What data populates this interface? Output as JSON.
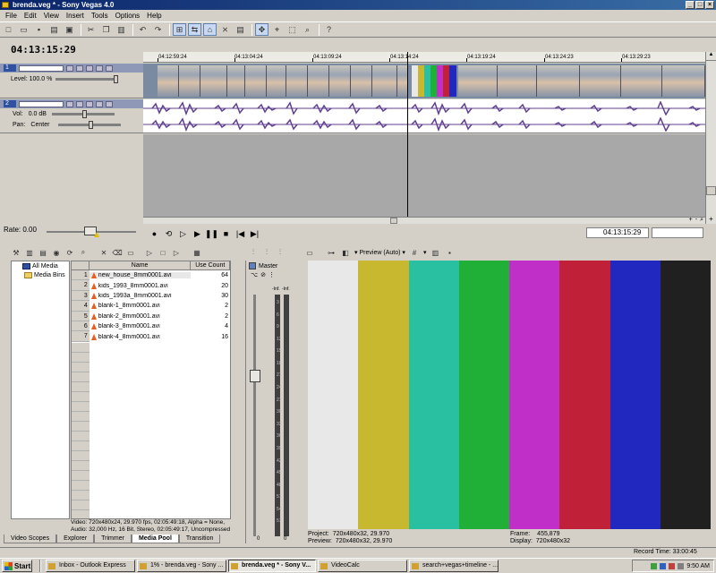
{
  "window": {
    "title": "brenda.veg * - Sony Vegas 4.0",
    "buttons": [
      "_",
      "□",
      "×"
    ]
  },
  "menu": [
    "File",
    "Edit",
    "View",
    "Insert",
    "Tools",
    "Options",
    "Help"
  ],
  "timeline": {
    "cursor_time": "04:13:15:29",
    "ruler_ticks": [
      "04:12:59:24",
      "04:13:04:24",
      "04:13:09:24",
      "04:13:14:24",
      "04:13:19:24",
      "04:13:24:23",
      "04:13:29:23"
    ],
    "end_time": "04:13:15:29"
  },
  "video_track": {
    "number": "1",
    "level_label": "Level: 100.0 %"
  },
  "audio_track": {
    "number": "2",
    "vol_label": "Vol:",
    "vol_value": "0.0 dB",
    "pan_label": "Pan:",
    "pan_value": "Center"
  },
  "rate": {
    "label": "Rate: 0.00"
  },
  "explorer_tree": [
    "All Media",
    "Media Bins"
  ],
  "media_pool": {
    "columns": [
      "Name",
      "Use Count"
    ],
    "rows": [
      {
        "n": "1",
        "name": "new_house_8mm0001.avi",
        "count": "64"
      },
      {
        "n": "2",
        "name": "kids_1993_8mm0001.avi",
        "count": "20"
      },
      {
        "n": "3",
        "name": "kids_1993a_8mm0001.avi",
        "count": "30"
      },
      {
        "n": "4",
        "name": "blank-1_8mm0001.avi",
        "count": "2"
      },
      {
        "n": "5",
        "name": "blank-2_8mm0001.avi",
        "count": "2"
      },
      {
        "n": "6",
        "name": "blank-3_8mm0001.avi",
        "count": "4"
      },
      {
        "n": "7",
        "name": "blank-4_8mm0001.avi",
        "count": "16"
      }
    ],
    "info_video": "Video: 720x480x24, 29.970 fps, 02:05:49:18, Alpha = None,",
    "info_audio": "Audio: 32,000 Hz, 16 Bit, Stereo, 02:05:49:17, Uncompressed"
  },
  "tabs": [
    "Video Scopes",
    "Explorer",
    "Trimmer",
    "Media Pool",
    "Transition"
  ],
  "active_tab": "Media Pool",
  "mixer": {
    "title": "Master",
    "scale": [
      "3",
      "6",
      "9",
      "12",
      "15",
      "18",
      "21",
      "24",
      "27",
      "30",
      "33",
      "36",
      "39",
      "42",
      "45",
      "48",
      "51",
      "54",
      "57"
    ],
    "inf_left": "-Inf.",
    "inf_right": "-Inf.",
    "bottom_left": "0",
    "bottom_right": "0"
  },
  "preview": {
    "mode": "Preview (Auto)",
    "bars": [
      "#e8e8e8",
      "#c8b830",
      "#28c0a0",
      "#20b038",
      "#c030c8",
      "#c02038",
      "#2028c0",
      "#202020"
    ],
    "project_label": "Project:",
    "project_value": "720x480x32, 29.970",
    "preview_label": "Preview:",
    "preview_value": "720x480x32, 29.970",
    "frame_label": "Frame:",
    "frame_value": "455,879",
    "display_label": "Display:",
    "display_value": "720x480x32"
  },
  "status": {
    "record_time": "Record Time: 33:00:45"
  },
  "taskbar": {
    "start": "Start",
    "tasks": [
      "Inbox - Outlook Express",
      "1% - brenda.veg - Sony ...",
      "brenda.veg * - Sony V...",
      "VideoCalc",
      "search+vegas+timeline - ..."
    ],
    "active_task": "brenda.veg * - Sony V...",
    "clock": "9:50 AM"
  }
}
